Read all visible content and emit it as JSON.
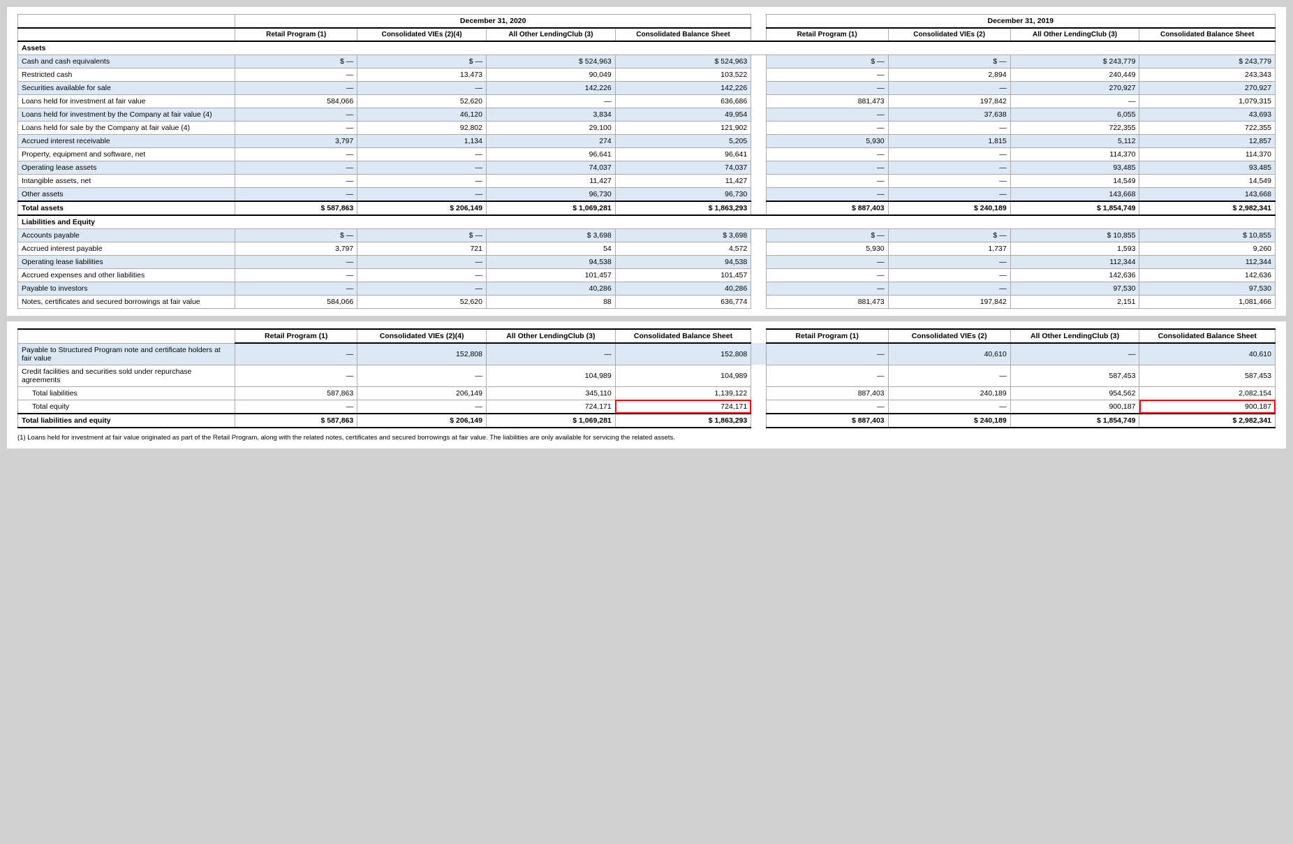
{
  "table": {
    "dec2020": {
      "group_label": "December 31, 2020",
      "col1": "Retail Program (1)",
      "col2": "Consolidated VIEs (2)(4)",
      "col3": "All Other LendingClub (3)",
      "col4": "Consolidated Balance Sheet"
    },
    "dec2019": {
      "group_label": "December 31, 2019",
      "col1": "Retail Program (1)",
      "col2": "Consolidated VIEs (2)",
      "col3": "All Other LendingClub (3)",
      "col4": "Consolidated Balance Sheet"
    },
    "sections": [
      {
        "type": "section-header",
        "label": "Assets"
      },
      {
        "type": "data",
        "label": "Cash and cash equivalents",
        "d2020": [
          "$ —",
          "$ —",
          "$ 524,963",
          "$ 524,963"
        ],
        "d2019": [
          "$ —",
          "$ —",
          "$ 243,779",
          "$ 243,779"
        ],
        "shade": true
      },
      {
        "type": "data",
        "label": "Restricted cash",
        "d2020": [
          "—",
          "13,473",
          "90,049",
          "103,522"
        ],
        "d2019": [
          "—",
          "2,894",
          "240,449",
          "243,343"
        ],
        "shade": false
      },
      {
        "type": "data",
        "label": "Securities available for sale",
        "d2020": [
          "—",
          "—",
          "142,226",
          "142,226"
        ],
        "d2019": [
          "—",
          "—",
          "270,927",
          "270,927"
        ],
        "shade": true
      },
      {
        "type": "data",
        "label": "Loans held for investment at fair value",
        "d2020": [
          "584,066",
          "52,620",
          "—",
          "636,686"
        ],
        "d2019": [
          "881,473",
          "197,842",
          "—",
          "1,079,315"
        ],
        "shade": false
      },
      {
        "type": "data",
        "label": "Loans held for investment by the Company at fair value (4)",
        "d2020": [
          "—",
          "46,120",
          "3,834",
          "49,954"
        ],
        "d2019": [
          "—",
          "37,638",
          "6,055",
          "43,693"
        ],
        "shade": true
      },
      {
        "type": "data",
        "label": "Loans held for sale by the Company at fair value (4)",
        "d2020": [
          "—",
          "92,802",
          "29,100",
          "121,902"
        ],
        "d2019": [
          "—",
          "—",
          "722,355",
          "722,355"
        ],
        "shade": false
      },
      {
        "type": "data",
        "label": "Accrued interest receivable",
        "d2020": [
          "3,797",
          "1,134",
          "274",
          "5,205"
        ],
        "d2019": [
          "5,930",
          "1,815",
          "5,112",
          "12,857"
        ],
        "shade": true
      },
      {
        "type": "data",
        "label": "Property, equipment and software, net",
        "d2020": [
          "—",
          "—",
          "96,641",
          "96,641"
        ],
        "d2019": [
          "—",
          "—",
          "114,370",
          "114,370"
        ],
        "shade": false
      },
      {
        "type": "data",
        "label": "Operating lease assets",
        "d2020": [
          "—",
          "—",
          "74,037",
          "74,037"
        ],
        "d2019": [
          "—",
          "—",
          "93,485",
          "93,485"
        ],
        "shade": true
      },
      {
        "type": "data",
        "label": "Intangible assets, net",
        "d2020": [
          "—",
          "—",
          "11,427",
          "11,427"
        ],
        "d2019": [
          "—",
          "—",
          "14,549",
          "14,549"
        ],
        "shade": false
      },
      {
        "type": "data",
        "label": "Other assets",
        "d2020": [
          "—",
          "—",
          "96,730",
          "96,730"
        ],
        "d2019": [
          "—",
          "—",
          "143,668",
          "143,668"
        ],
        "shade": true
      },
      {
        "type": "total",
        "label": "Total assets",
        "d2020": [
          "$ 587,863",
          "$ 206,149",
          "$ 1,069,281",
          "$ 1,863,293"
        ],
        "d2019": [
          "$ 887,403",
          "$ 240,189",
          "$ 1,854,749",
          "$ 2,982,341"
        ]
      },
      {
        "type": "section-header",
        "label": "Liabilities and Equity"
      },
      {
        "type": "data",
        "label": "Accounts payable",
        "d2020": [
          "$ —",
          "$ —",
          "$ 3,698",
          "$ 3,698"
        ],
        "d2019": [
          "$ —",
          "$ —",
          "$ 10,855",
          "$ 10,855"
        ],
        "shade": true
      },
      {
        "type": "data",
        "label": "Accrued interest payable",
        "d2020": [
          "3,797",
          "721",
          "54",
          "4,572"
        ],
        "d2019": [
          "5,930",
          "1,737",
          "1,593",
          "9,260"
        ],
        "shade": false
      },
      {
        "type": "data",
        "label": "Operating lease liabilities",
        "d2020": [
          "—",
          "—",
          "94,538",
          "94,538"
        ],
        "d2019": [
          "—",
          "—",
          "112,344",
          "112,344"
        ],
        "shade": true
      },
      {
        "type": "data",
        "label": "Accrued expenses and other liabilities",
        "d2020": [
          "—",
          "—",
          "101,457",
          "101,457"
        ],
        "d2019": [
          "—",
          "—",
          "142,636",
          "142,636"
        ],
        "shade": false
      },
      {
        "type": "data",
        "label": "Payable to investors",
        "d2020": [
          "—",
          "—",
          "40,286",
          "40,286"
        ],
        "d2019": [
          "—",
          "—",
          "97,530",
          "97,530"
        ],
        "shade": true
      },
      {
        "type": "data",
        "label": "Notes, certificates and secured borrowings at fair value",
        "d2020": [
          "584,066",
          "52,620",
          "88",
          "636,774"
        ],
        "d2019": [
          "881,473",
          "197,842",
          "2,151",
          "1,081,466"
        ],
        "shade": false
      }
    ],
    "bottom_sections": [
      {
        "type": "data",
        "label": "Payable to Structured Program note and certificate holders at fair value",
        "d2020": [
          "—",
          "152,808",
          "—",
          "152,808"
        ],
        "d2019": [
          "—",
          "40,610",
          "—",
          "40,610"
        ],
        "shade": true
      },
      {
        "type": "data",
        "label": "Credit facilities and securities sold under repurchase agreements",
        "d2020": [
          "—",
          "—",
          "104,989",
          "104,989"
        ],
        "d2019": [
          "—",
          "—",
          "587,453",
          "587,453"
        ],
        "shade": false
      },
      {
        "type": "subtotal",
        "label": "Total liabilities",
        "d2020": [
          "587,863",
          "206,149",
          "345,110",
          "1,139,122"
        ],
        "d2019": [
          "887,403",
          "240,189",
          "954,562",
          "2,082,154"
        ]
      },
      {
        "type": "subtotal",
        "label": "Total equity",
        "d2020": [
          "—",
          "—",
          "724,171",
          "724,171"
        ],
        "d2019": [
          "—",
          "—",
          "900,187",
          "900,187"
        ],
        "highlight": [
          3,
          7
        ]
      },
      {
        "type": "total",
        "label": "Total liabilities and equity",
        "d2020": [
          "$ 587,863",
          "$ 206,149",
          "$ 1,069,281",
          "$ 1,863,293"
        ],
        "d2019": [
          "$ 887,403",
          "$ 240,189",
          "$ 1,854,749",
          "$ 2,982,341"
        ]
      }
    ],
    "footnote": "(1) Loans held for investment at fair value originated as part of the Retail Program, along with the related notes, certificates and secured borrowings at fair value. The liabilities are only available for servicing the related assets."
  }
}
